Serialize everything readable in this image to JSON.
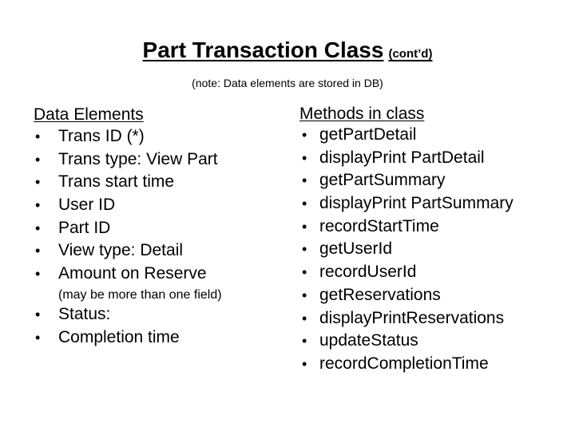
{
  "slide": {
    "title": "Part Transaction Class",
    "title_suffix": "(cont’d)",
    "note": "(note: Data elements are stored in DB)"
  },
  "data_elements": {
    "header": "Data Elements",
    "items": [
      "Trans ID (*)",
      "Trans type: View Part",
      "Trans start time",
      "User ID",
      "Part ID",
      "View type: Detail",
      "Amount on Reserve"
    ],
    "sub_note": "(may be more than one field)",
    "items_after": [
      "Status:",
      "Completion time"
    ]
  },
  "methods": {
    "header": "Methods in class",
    "items": [
      "getPartDetail",
      "displayPrint PartDetail",
      "getPartSummary",
      "displayPrint PartSummary",
      "recordStartTime",
      "getUserId",
      "recordUserId",
      "getReservations",
      "displayPrintReservations",
      "updateStatus",
      "recordCompletionTime"
    ]
  },
  "bullet_glyph": "•"
}
